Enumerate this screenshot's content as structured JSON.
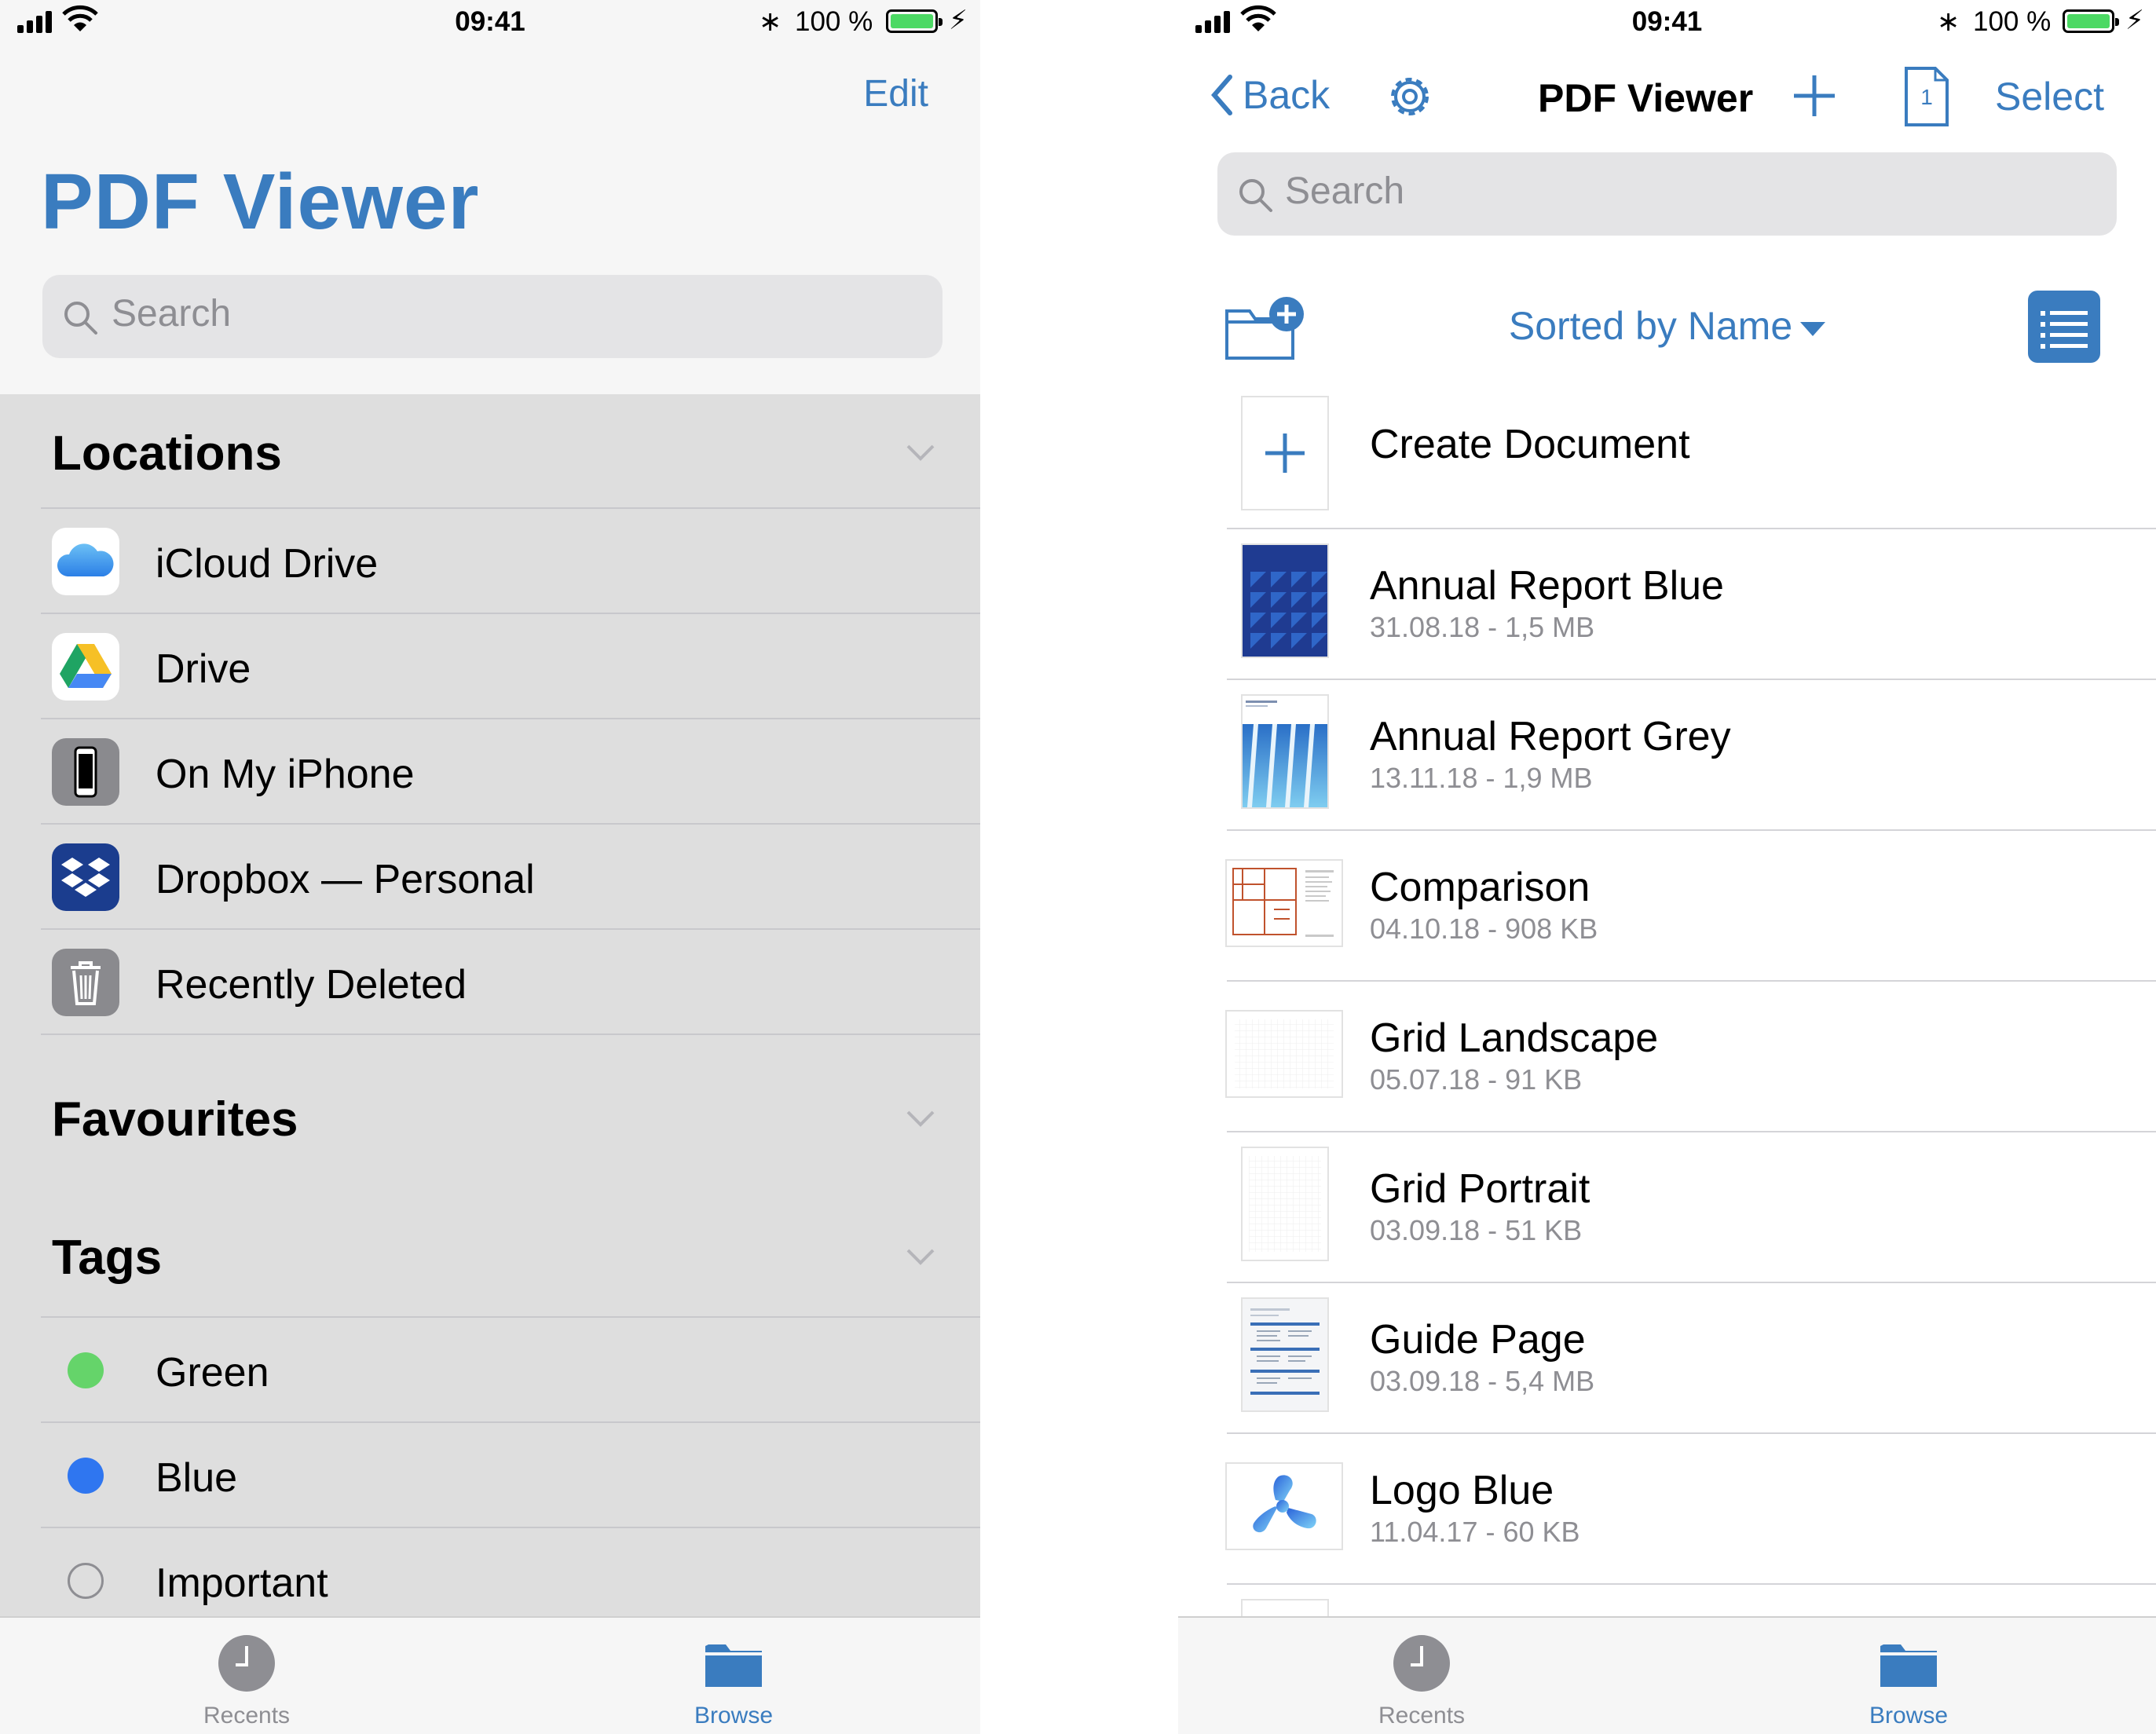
{
  "status_bar": {
    "time": "09:41",
    "battery_percent": "100 %",
    "battery_level": 1.0
  },
  "left": {
    "edit_label": "Edit",
    "title": "PDF Viewer",
    "search_placeholder": "Search",
    "locations_title": "Locations",
    "locations": [
      {
        "label": "iCloud Drive",
        "icon": "icloud-icon"
      },
      {
        "label": "Drive",
        "icon": "google-drive-icon"
      },
      {
        "label": "On My iPhone",
        "icon": "iphone-icon"
      },
      {
        "label": "Dropbox — Personal",
        "icon": "dropbox-icon"
      },
      {
        "label": "Recently Deleted",
        "icon": "trash-icon"
      }
    ],
    "favourites_title": "Favourites",
    "tags_title": "Tags",
    "tags": [
      {
        "label": "Green",
        "color": "#65d46a"
      },
      {
        "label": "Blue",
        "color": "#2f76f0"
      },
      {
        "label": "Important",
        "color": ""
      }
    ]
  },
  "right": {
    "back_label": "Back",
    "title": "PDF Viewer",
    "select_label": "Select",
    "doc_badge": "1",
    "search_placeholder": "Search",
    "sort_label": "Sorted by Name",
    "create_label": "Create Document",
    "documents": [
      {
        "name": "Annual Report Blue",
        "meta": "31.08.18 - 1,5 MB",
        "thumb": "annual-blue"
      },
      {
        "name": "Annual Report Grey",
        "meta": "13.11.18 - 1,9 MB",
        "thumb": "annual-grey"
      },
      {
        "name": "Comparison",
        "meta": "04.10.18 - 908 KB",
        "thumb": "comparison"
      },
      {
        "name": "Grid Landscape",
        "meta": "05.07.18 - 91 KB",
        "thumb": "grid-landscape"
      },
      {
        "name": "Grid Portrait",
        "meta": "03.09.18 - 51 KB",
        "thumb": "grid-portrait"
      },
      {
        "name": "Guide Page",
        "meta": "03.09.18 - 5,4 MB",
        "thumb": "guide"
      },
      {
        "name": "Logo Blue",
        "meta": "11.04.17 - 60 KB",
        "thumb": "logo"
      }
    ]
  },
  "tabbar": {
    "recents_label": "Recents",
    "browse_label": "Browse",
    "active": "Browse"
  },
  "colors": {
    "accent": "#3a7cbf",
    "inactive_tab": "#8e8e93"
  }
}
